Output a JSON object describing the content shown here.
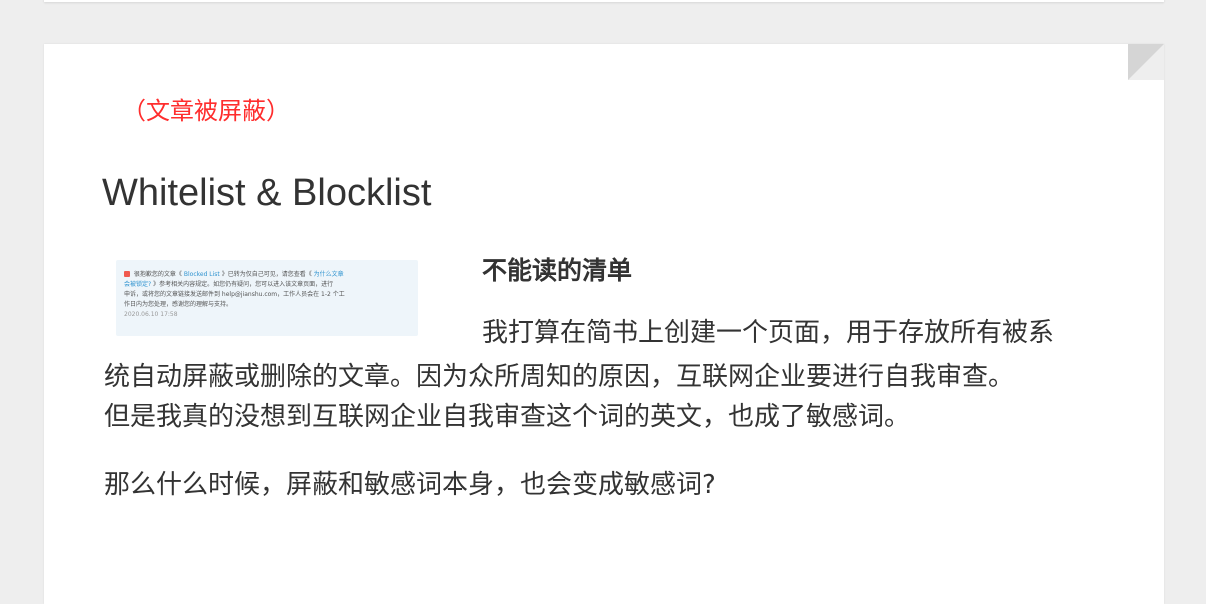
{
  "article": {
    "blocked_note": "（文章被屏蔽）",
    "title": "Whitelist & Blocklist",
    "image_notice": {
      "line1_text": "很抱歉您的文章《",
      "line1_link": "Blocked List",
      "line1_rest": "》已转为仅自己可见，请您查看《",
      "line1_link2": "为什么文章",
      "line2_link": "会被锁定?",
      "line2_rest": "》参考相关内容规定。如您仍有疑问，您可以进入该文章页面，进行",
      "line3": "申诉，或将您的文章链接发送邮件到 help@jianshu.com，工作人员会在 1-2 个工",
      "line4": "作日内为您处理，感谢您的理解与支持。",
      "date": "2020.06.10 17:58"
    },
    "subheading": "不能读的清单",
    "paragraph1_line1": "我打算在简书上创建一个页面，用于存放所有被系",
    "paragraph1_line2": "统自动屏蔽或删除的文章。因为众所周知的原因，互联网企业要进行自我审查。",
    "paragraph1_line3": "但是我真的没想到互联网企业自我审查这个词的英文，也成了敏感词。",
    "paragraph2": "那么什么时候，屏蔽和敏感词本身，也会变成敏感词?"
  },
  "colors": {
    "blocked_note": "#ff2d2d",
    "link": "#3194d0",
    "page_background": "#eeeeee",
    "card_background": "#ffffff",
    "text": "#333333"
  }
}
